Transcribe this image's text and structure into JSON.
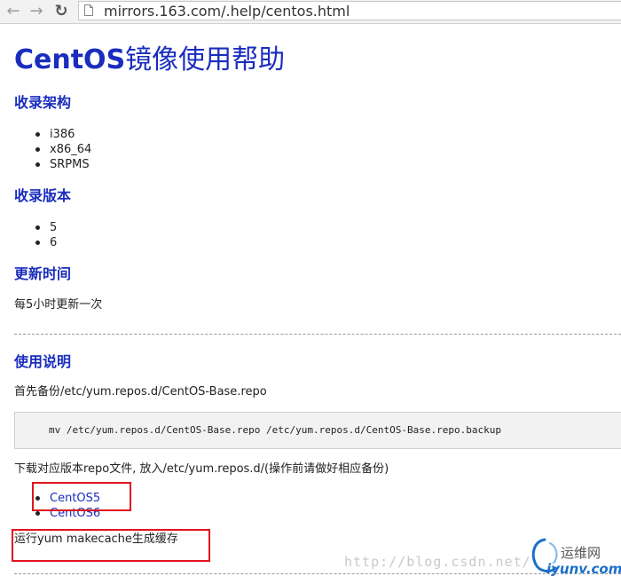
{
  "browser": {
    "back_icon": "arrow-left-icon",
    "forward_icon": "arrow-right-icon",
    "reload_icon": "reload-icon",
    "url": "mirrors.163.com/.help/centos.html"
  },
  "page": {
    "title_latin": "CentOS",
    "title_cn": "镜像使用帮助",
    "sections": {
      "arch": {
        "heading": "收录架构",
        "items": [
          "i386",
          "x86_64",
          "SRPMS"
        ]
      },
      "version": {
        "heading": "收录版本",
        "items": [
          "5",
          "6"
        ]
      },
      "update": {
        "heading": "更新时间",
        "text": "每5小时更新一次"
      },
      "usage": {
        "heading": "使用说明",
        "backup_text": "首先备份/etc/yum.repos.d/CentOS-Base.repo",
        "code": "mv /etc/yum.repos.d/CentOS-Base.repo /etc/yum.repos.d/CentOS-Base.repo.backup",
        "download_text": "下载对应版本repo文件, 放入/etc/yum.repos.d/(操作前请做好相应备份)",
        "links": [
          "CentOS5",
          "CentOS6"
        ],
        "makecache_text": "运行yum makecache生成缓存"
      }
    }
  },
  "annotations": {
    "highlight_color": "#e0141e"
  },
  "watermark": {
    "url_text": "http://blog.csdn.net/",
    "logo_cn": "运维网",
    "logo_en": "iyunv.com"
  },
  "colors": {
    "heading": "#1a2dbd",
    "text": "#222222"
  }
}
